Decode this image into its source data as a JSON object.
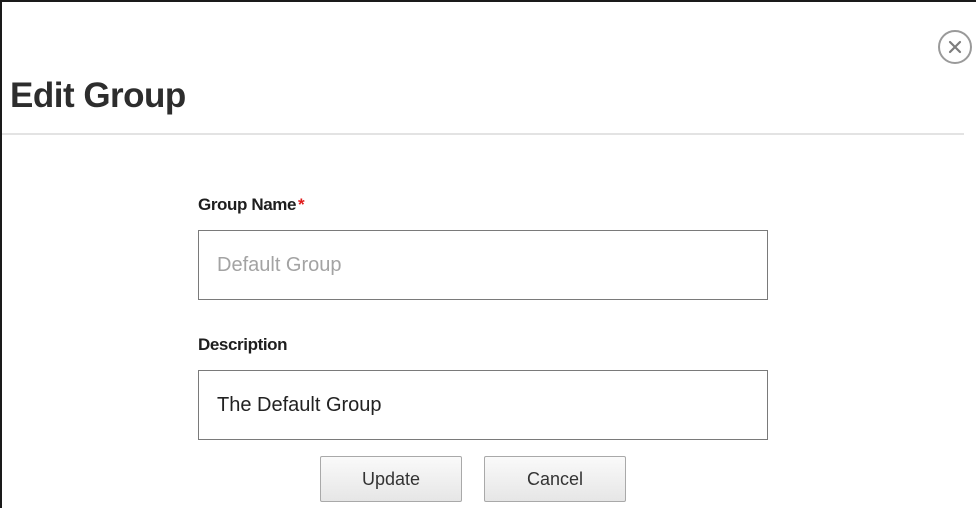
{
  "dialog": {
    "title": "Edit Group",
    "close_icon": "close-circle-icon"
  },
  "form": {
    "group_name": {
      "label": "Group Name",
      "required_marker": "*",
      "value": "",
      "placeholder": "Default Group"
    },
    "description": {
      "label": "Description",
      "value": "The Default Group"
    }
  },
  "buttons": {
    "update_label": "Update",
    "cancel_label": "Cancel"
  },
  "colors": {
    "required": "#e01b1b",
    "title": "#2d2d2d",
    "border": "#7a7a7a"
  }
}
